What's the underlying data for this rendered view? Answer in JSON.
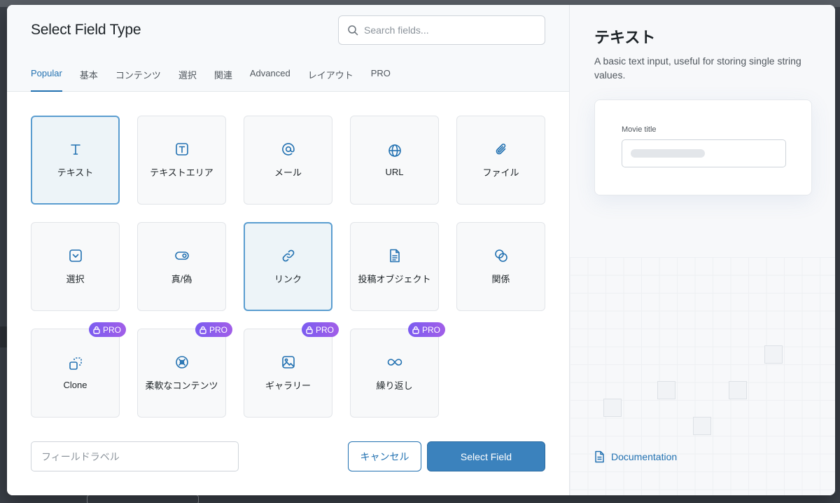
{
  "dialog": {
    "title": "Select Field Type"
  },
  "search": {
    "placeholder": "Search fields..."
  },
  "tabs": [
    {
      "label": "Popular",
      "active": true
    },
    {
      "label": "基本"
    },
    {
      "label": "コンテンツ"
    },
    {
      "label": "選択"
    },
    {
      "label": "関連"
    },
    {
      "label": "Advanced"
    },
    {
      "label": "レイアウト"
    },
    {
      "label": "PRO"
    }
  ],
  "fields": [
    {
      "label": "テキスト",
      "icon": "text-icon",
      "state": "selected"
    },
    {
      "label": "テキストエリア",
      "icon": "textarea-icon"
    },
    {
      "label": "メール",
      "icon": "at-sign-icon"
    },
    {
      "label": "URL",
      "icon": "globe-icon"
    },
    {
      "label": "ファイル",
      "icon": "paperclip-icon"
    },
    {
      "label": "選択",
      "icon": "select-dropdown-icon"
    },
    {
      "label": "真/偽",
      "icon": "toggle-icon"
    },
    {
      "label": "リンク",
      "icon": "link-icon",
      "state": "hover"
    },
    {
      "label": "投稿オブジェクト",
      "icon": "document-icon"
    },
    {
      "label": "関係",
      "icon": "relationship-icon"
    },
    {
      "label": "Clone",
      "icon": "clone-icon",
      "pro": true
    },
    {
      "label": "柔軟なコンテンツ",
      "icon": "flexible-content-icon",
      "pro": true
    },
    {
      "label": "ギャラリー",
      "icon": "gallery-icon",
      "pro": true
    },
    {
      "label": "繰り返し",
      "icon": "infinity-icon",
      "pro": true
    }
  ],
  "pro_badge": {
    "label": "PRO",
    "icon": "lock-icon"
  },
  "footer": {
    "field_label_placeholder": "フィールドラベル",
    "cancel_label": "キャンセル",
    "select_label": "Select Field"
  },
  "preview": {
    "title": "テキスト",
    "description": "A basic text input, useful for storing single string values.",
    "example_label": "Movie title",
    "documentation_label": "Documentation",
    "documentation_icon": "document-icon"
  },
  "colors": {
    "accent": "#2271b1",
    "primary_button": "#3b82bd",
    "pro_gradient_start": "#7b5cf0",
    "pro_gradient_end": "#a15ee8",
    "selected_border": "#5a9dd0"
  }
}
